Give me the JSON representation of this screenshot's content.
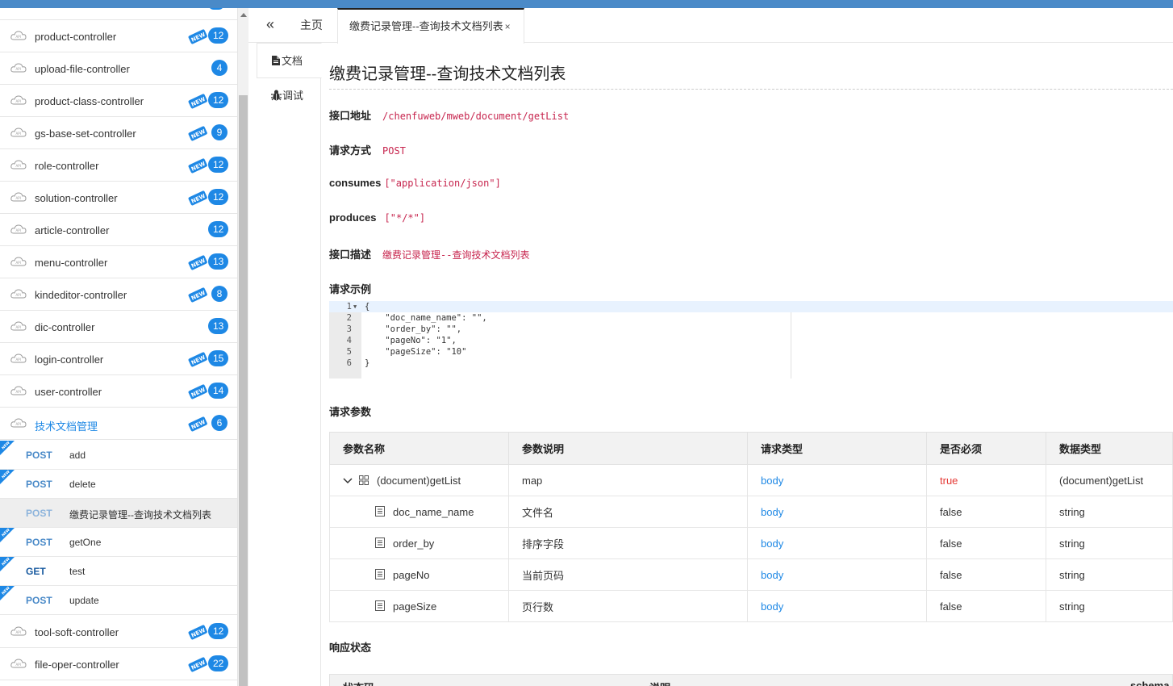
{
  "sidebar": {
    "controllers": [
      {
        "label": "product-controller",
        "count": "12",
        "is_new": true
      },
      {
        "label": "upload-file-controller",
        "count": "4",
        "is_new": false
      },
      {
        "label": "product-class-controller",
        "count": "12",
        "is_new": true
      },
      {
        "label": "gs-base-set-controller",
        "count": "9",
        "is_new": true
      },
      {
        "label": "role-controller",
        "count": "12",
        "is_new": true
      },
      {
        "label": "solution-controller",
        "count": "12",
        "is_new": true
      },
      {
        "label": "article-controller",
        "count": "12",
        "is_new": false
      },
      {
        "label": "menu-controller",
        "count": "13",
        "is_new": true
      },
      {
        "label": "kindeditor-controller",
        "count": "8",
        "is_new": true
      },
      {
        "label": "dic-controller",
        "count": "13",
        "is_new": false
      },
      {
        "label": "login-controller",
        "count": "15",
        "is_new": true
      },
      {
        "label": "user-controller",
        "count": "14",
        "is_new": true
      },
      {
        "label": "技术文档管理",
        "count": "6",
        "is_new": true
      }
    ],
    "operations": [
      {
        "method": "POST",
        "name": "add",
        "is_new": true
      },
      {
        "method": "POST",
        "name": "delete",
        "is_new": true
      },
      {
        "method": "POST",
        "name": "缴费记录管理--查询技术文档列表",
        "is_new": false
      },
      {
        "method": "POST",
        "name": "getOne",
        "is_new": true
      },
      {
        "method": "GET",
        "name": "test",
        "is_new": true
      },
      {
        "method": "POST",
        "name": "update",
        "is_new": true
      }
    ],
    "more_controllers": [
      {
        "label": "tool-soft-controller",
        "count": "12",
        "is_new": true
      },
      {
        "label": "file-oper-controller",
        "count": "22",
        "is_new": true
      }
    ]
  },
  "tabs": {
    "collapse": "«",
    "home": "主页",
    "active": "缴费记录管理--查询技术文档列表",
    "close": "×"
  },
  "sidetabs": {
    "doc": "文档",
    "debug": "调试"
  },
  "doc": {
    "title": "缴费记录管理--查询技术文档列表",
    "url_label": "接口地址",
    "url": "/chenfuweb/mweb/document/getList",
    "method_label": "请求方式",
    "method": "POST",
    "consumes_label": "consumes",
    "consumes": "[\"application/json\"]",
    "produces_label": "produces",
    "produces": "[\"*/*\"]",
    "desc_label": "接口描述",
    "desc": "缴费记录管理--查询技术文档列表",
    "example_label": "请求示例",
    "example_lines": [
      "{",
      "    \"doc_name_name\": \"\",",
      "    \"order_by\": \"\",",
      "    \"pageNo\": \"1\",",
      "    \"pageSize\": \"10\"",
      "}"
    ],
    "params_label": "请求参数",
    "params_headers": [
      "参数名称",
      "参数说明",
      "请求类型",
      "是否必须",
      "数据类型"
    ],
    "params_rows": [
      {
        "name": "(document)getList",
        "desc": "map",
        "in": "body",
        "required": "true",
        "type": "(document)getList",
        "level": 0
      },
      {
        "name": "doc_name_name",
        "desc": "文件名",
        "in": "body",
        "required": "false",
        "type": "string",
        "level": 1
      },
      {
        "name": "order_by",
        "desc": "排序字段",
        "in": "body",
        "required": "false",
        "type": "string",
        "level": 1
      },
      {
        "name": "pageNo",
        "desc": "当前页码",
        "in": "body",
        "required": "false",
        "type": "string",
        "level": 1
      },
      {
        "name": "pageSize",
        "desc": "页行数",
        "in": "body",
        "required": "false",
        "type": "string",
        "level": 1
      }
    ],
    "response_label": "响应状态",
    "response_headers": [
      "状态码",
      "说明",
      "schema"
    ]
  },
  "colors": {
    "accent": "#1e88e5",
    "topbar": "#4a8ac8",
    "required": "#e53935"
  }
}
